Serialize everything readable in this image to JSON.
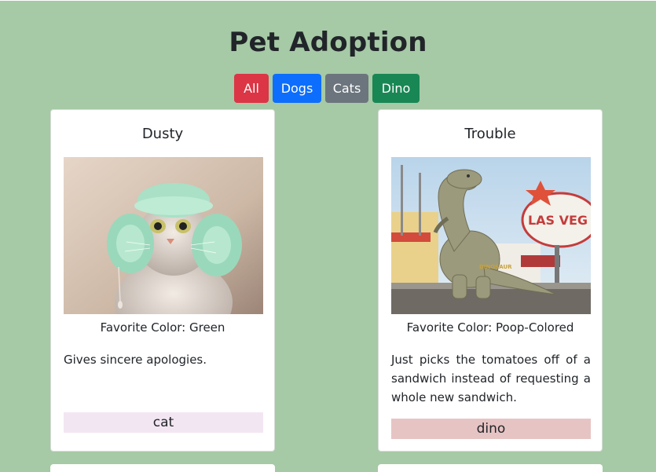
{
  "page": {
    "title": "Pet Adoption",
    "background": "#a6c9a6"
  },
  "filters": [
    {
      "label": "All",
      "color": "#dc3545"
    },
    {
      "label": "Dogs",
      "color": "#0d6efd"
    },
    {
      "label": "Cats",
      "color": "#6c757d"
    },
    {
      "label": "Dino",
      "color": "#198754"
    }
  ],
  "pets": [
    {
      "name": "Dusty",
      "favorite_color": "Favorite Color: Green",
      "description": "Gives sincere apologies.",
      "type": "cat",
      "type_color": "#f3e6f3",
      "image": "cat-photo"
    },
    {
      "name": "Trouble",
      "favorite_color": "Favorite Color: Poop-Colored",
      "description": "Just picks the tomatoes off of a sandwich instead of requesting a whole new sandwich.",
      "type": "dino",
      "type_color": "#e7c4c4",
      "image": "dino-photo"
    }
  ]
}
